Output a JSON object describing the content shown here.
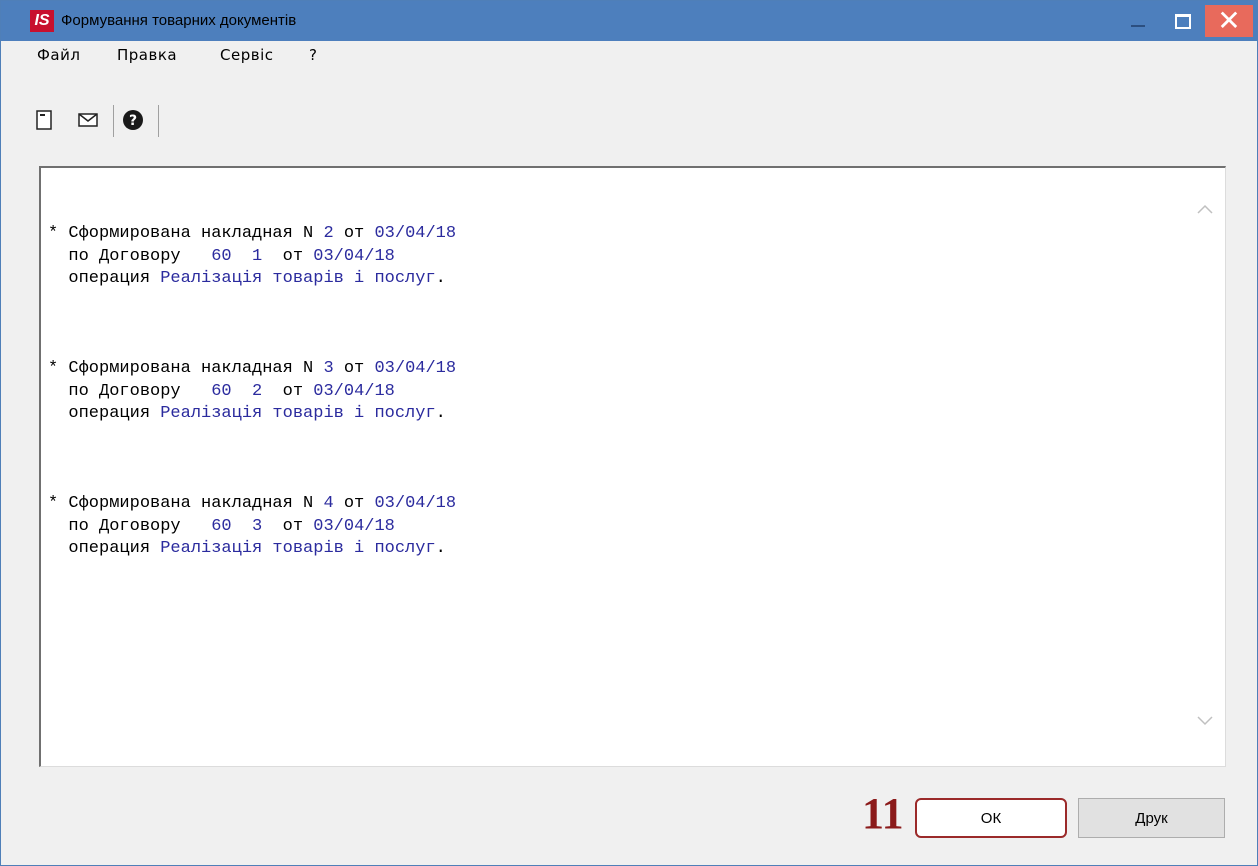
{
  "window": {
    "title": "Формування товарних документів",
    "logo_text": "IS",
    "close_glyph": "✕"
  },
  "menu": {
    "items": [
      "Файл",
      "Правка",
      "Сервіс",
      "?"
    ]
  },
  "toolbar": {
    "icons": [
      "document-icon",
      "envelope-icon",
      "help-icon"
    ]
  },
  "log": {
    "entries": [
      {
        "line1_prefix": "* Сформирована накладная N ",
        "number": "2",
        "line1_mid": " от ",
        "date": "03/04/18",
        "line2_prefix": "  по Договору   ",
        "contract": "60  1",
        "line2_mid": "  от ",
        "contract_date": "03/04/18",
        "line3_prefix": "  операция ",
        "operation": "Реалізація товарів і послуг",
        "line3_suffix": "."
      },
      {
        "line1_prefix": "* Сформирована накладная N ",
        "number": "3",
        "line1_mid": " от ",
        "date": "03/04/18",
        "line2_prefix": "  по Договору   ",
        "contract": "60  2",
        "line2_mid": "  от ",
        "contract_date": "03/04/18",
        "line3_prefix": "  операция ",
        "operation": "Реалізація товарів і послуг",
        "line3_suffix": "."
      },
      {
        "line1_prefix": "* Сформирована накладная N ",
        "number": "4",
        "line1_mid": " от ",
        "date": "03/04/18",
        "line2_prefix": "  по Договору   ",
        "contract": "60  3",
        "line2_mid": "  от ",
        "contract_date": "03/04/18",
        "line3_prefix": "  операция ",
        "operation": "Реалізація товарів і послуг",
        "line3_suffix": "."
      }
    ]
  },
  "annotation": {
    "step": "11"
  },
  "buttons": {
    "ok": "ОК",
    "print": "Друк"
  },
  "colors": {
    "titlebar": "#4d7fbd",
    "highlight_text": "#2b2b9e",
    "annotation": "#8b1a1a",
    "close": "#e86a5c"
  }
}
